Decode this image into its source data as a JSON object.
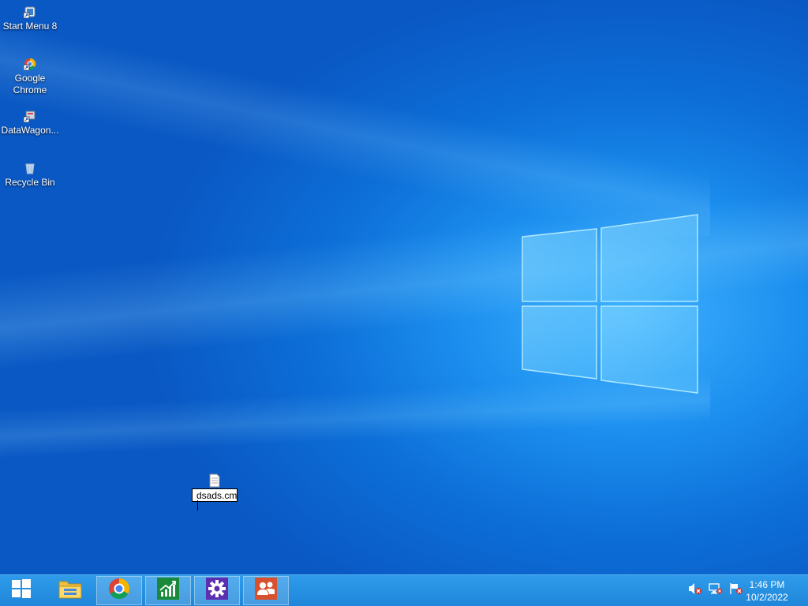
{
  "desktop": {
    "icons": [
      {
        "label": "Start Menu 8",
        "icon": "start-menu-shortcut-icon"
      },
      {
        "label": "Google Chrome",
        "icon": "chrome-shortcut-icon"
      },
      {
        "label": "DataWagon...",
        "icon": "datawagon-shortcut-icon"
      },
      {
        "label": "Recycle Bin",
        "icon": "recycle-bin-icon"
      }
    ],
    "rename": {
      "value": "dsads.cm",
      "icon": "text-file-icon"
    }
  },
  "taskbar": {
    "start": "windows-start-icon",
    "apps": [
      {
        "name": "file-explorer",
        "icon": "folder-icon"
      },
      {
        "name": "google-chrome",
        "icon": "chrome-icon"
      },
      {
        "name": "chart-app",
        "icon": "chart-icon"
      },
      {
        "name": "settings",
        "icon": "gear-icon"
      },
      {
        "name": "people",
        "icon": "people-icon"
      }
    ],
    "tray": [
      "volume-muted-icon",
      "network-error-icon",
      "action-center-flag-icon"
    ],
    "clock": {
      "time": "1:46 PM",
      "date": "10/2/2022"
    }
  },
  "colors": {
    "taskbar": "#2590e0",
    "accent": "#0a58c4"
  }
}
